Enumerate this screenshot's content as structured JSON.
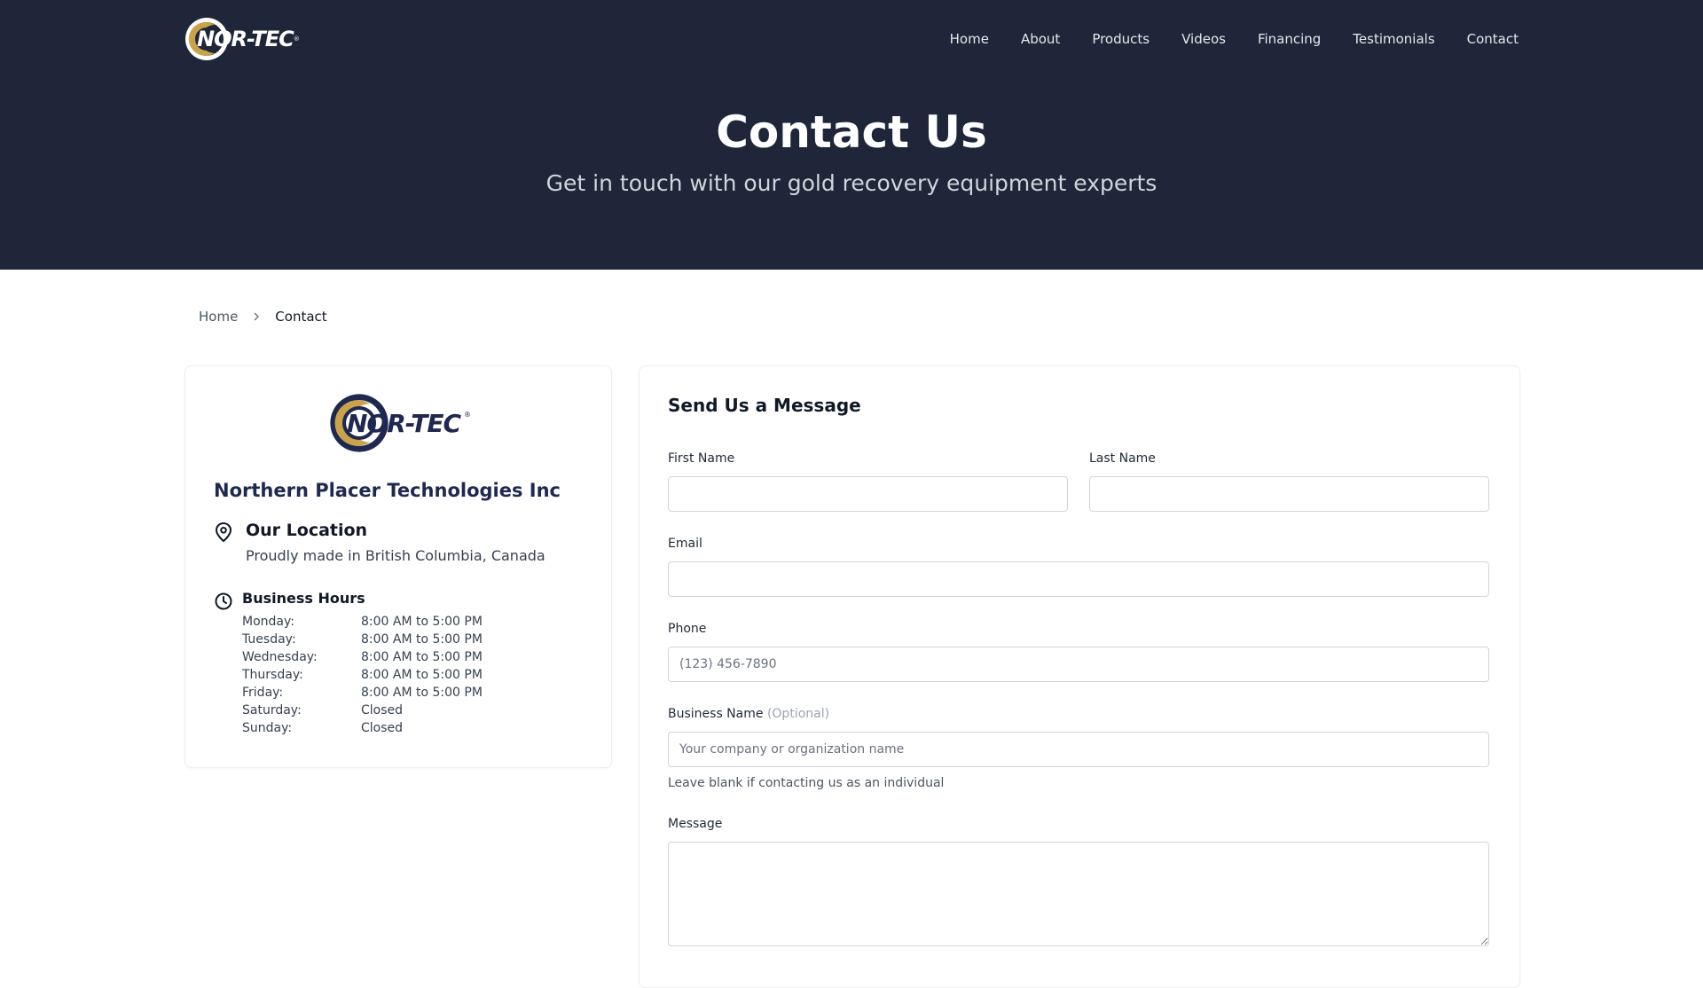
{
  "brand": {
    "logo_text": "NOR-TEC",
    "logo_mark": "®"
  },
  "nav": {
    "items": [
      {
        "label": "Home"
      },
      {
        "label": "About"
      },
      {
        "label": "Products"
      },
      {
        "label": "Videos"
      },
      {
        "label": "Financing"
      },
      {
        "label": "Testimonials"
      },
      {
        "label": "Contact"
      }
    ]
  },
  "hero": {
    "title": "Contact Us",
    "subtitle": "Get in touch with our gold recovery equipment experts"
  },
  "breadcrumb": {
    "home": "Home",
    "current": "Contact"
  },
  "company": {
    "name": "Northern Placer Technologies Inc",
    "location_title": "Our Location",
    "location_text": "Proudly made in British Columbia, Canada",
    "hours_title": "Business Hours",
    "hours": [
      {
        "day": "Monday:",
        "time": "8:00 AM to 5:00 PM"
      },
      {
        "day": "Tuesday:",
        "time": "8:00 AM to 5:00 PM"
      },
      {
        "day": "Wednesday:",
        "time": "8:00 AM to 5:00 PM"
      },
      {
        "day": "Thursday:",
        "time": "8:00 AM to 5:00 PM"
      },
      {
        "day": "Friday:",
        "time": "8:00 AM to 5:00 PM"
      },
      {
        "day": "Saturday:",
        "time": "Closed"
      },
      {
        "day": "Sunday:",
        "time": "Closed"
      }
    ]
  },
  "form": {
    "title": "Send Us a Message",
    "first_name": {
      "label": "First Name",
      "value": "",
      "placeholder": ""
    },
    "last_name": {
      "label": "Last Name",
      "value": "",
      "placeholder": ""
    },
    "email": {
      "label": "Email",
      "value": "",
      "placeholder": ""
    },
    "phone": {
      "label": "Phone",
      "value": "",
      "placeholder": "(123) 456-7890"
    },
    "business": {
      "label": "Business Name",
      "optional": "(Optional)",
      "value": "",
      "placeholder": "Your company or organization name",
      "hint": "Leave blank if contacting us as an individual"
    },
    "message": {
      "label": "Message",
      "value": "",
      "placeholder": ""
    }
  },
  "colors": {
    "hero_bg": "#1f2639",
    "brand_navy": "#1e2850",
    "logo_gold": "#c9a24a"
  }
}
